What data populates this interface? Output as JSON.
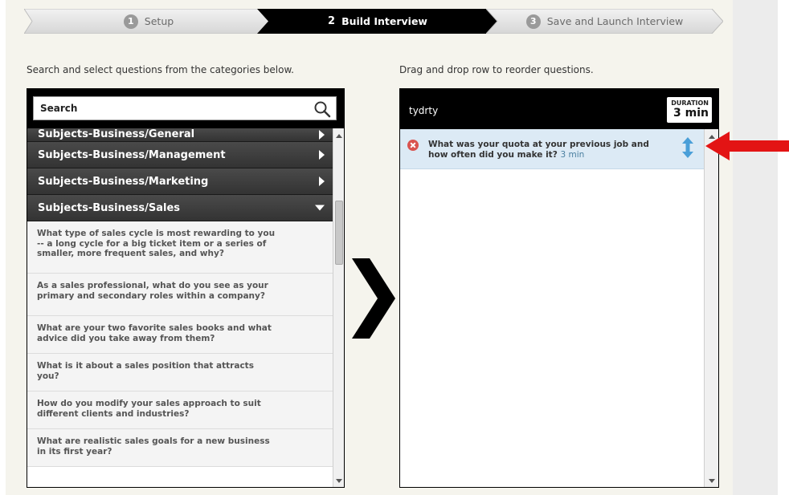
{
  "wizard": {
    "steps": [
      {
        "number": "1",
        "label": "Setup"
      },
      {
        "number": "2",
        "label": "Build Interview"
      },
      {
        "number": "3",
        "label": "Save and Launch Interview"
      }
    ]
  },
  "left": {
    "instruction": "Search and select questions from the categories below.",
    "search_placeholder": "Search",
    "categories": [
      "Subjects-Business/General",
      "Subjects-Business/Management",
      "Subjects-Business/Marketing",
      "Subjects-Business/Sales"
    ],
    "questions": [
      "What type of sales cycle is most rewarding to you -- a long cycle for a big ticket item or a series of smaller, more frequent sales, and why?",
      "As a sales professional, what do you see as your primary and secondary roles within a company?",
      "What are your two favorite sales books and what advice did you take away from them?",
      "What is it about a sales position that attracts you?",
      "How do you modify your sales approach to suit different clients and industries?",
      "What are realistic sales goals for a new business in its first year?"
    ]
  },
  "right": {
    "instruction": "Drag and drop row to reorder questions.",
    "interview_name": "tydrty",
    "duration_label": "DURATION",
    "duration_value": "3 min",
    "selected": [
      {
        "text": "What was your quota at your previous job and how often did you make it?",
        "duration": "3 min"
      }
    ]
  },
  "colors": {
    "active_step": "#000000",
    "selected_row": "#dceaf5",
    "annotation_arrow": "#e31414",
    "remove_icon": "#d9534f",
    "reorder_icon": "#4a9fd8"
  }
}
